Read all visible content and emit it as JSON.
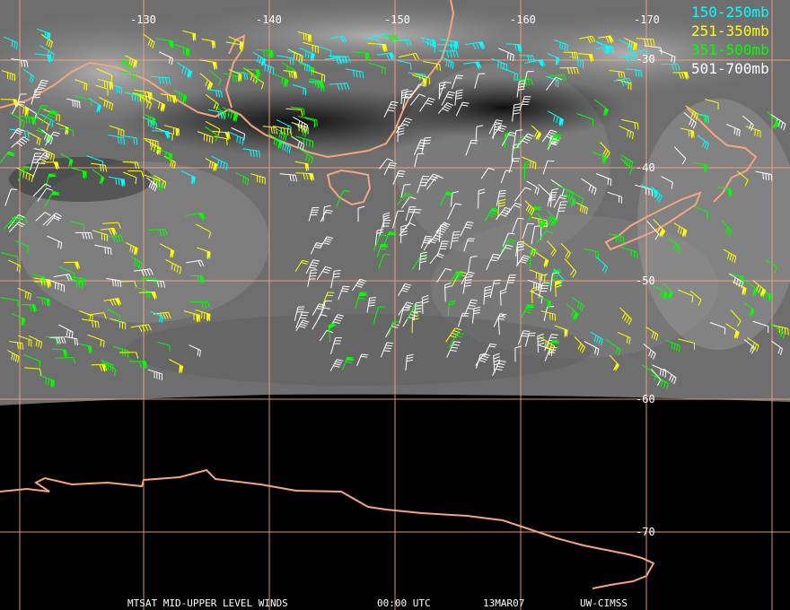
{
  "legend": [
    {
      "label": "150-250mb",
      "color": "#00ffff"
    },
    {
      "label": "251-350mb",
      "color": "#ffff00"
    },
    {
      "label": "351-500mb",
      "color": "#00ff00"
    },
    {
      "label": "501-700mb",
      "color": "#ffffff"
    }
  ],
  "longitude_labels": [
    "-130",
    "-140",
    "-150",
    "-160",
    "-170"
  ],
  "latitude_labels": [
    "-30",
    "-40",
    "-50",
    "-60",
    "-70"
  ],
  "footer": {
    "product": "MTSAT MID-UPPER LEVEL WINDS",
    "time": "00:00 UTC",
    "date": "13MAR07",
    "source": "UW-CIMSS"
  },
  "colors": {
    "grid": "#f4a57f",
    "coastline": "#f4a57f",
    "space": "#000000"
  }
}
